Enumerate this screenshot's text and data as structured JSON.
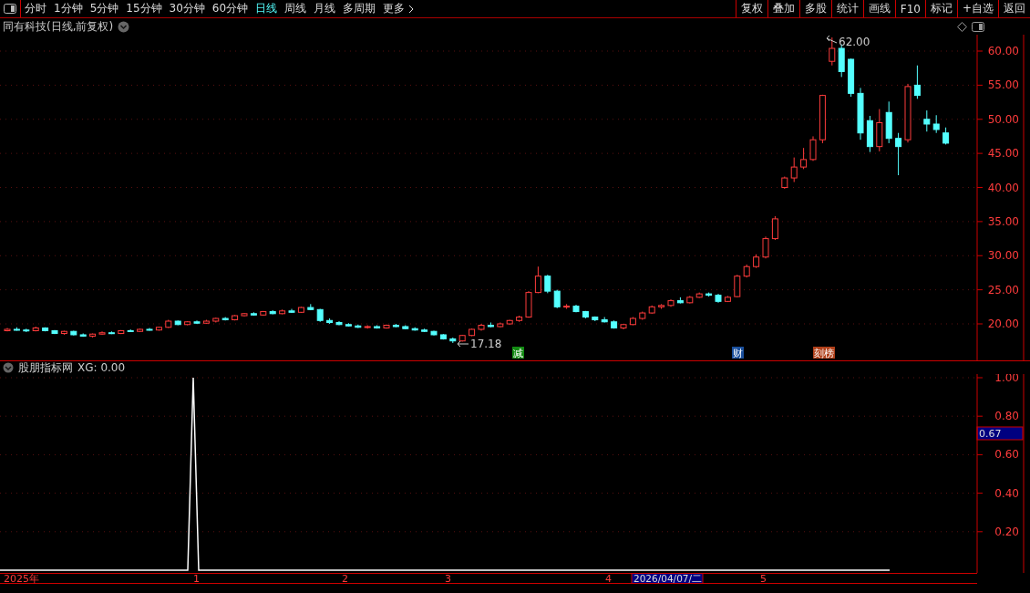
{
  "toolbar": {
    "periods": [
      {
        "label": "分时",
        "selected": false
      },
      {
        "label": "1分钟",
        "selected": false
      },
      {
        "label": "5分钟",
        "selected": false
      },
      {
        "label": "15分钟",
        "selected": false
      },
      {
        "label": "30分钟",
        "selected": false
      },
      {
        "label": "60分钟",
        "selected": false
      },
      {
        "label": "日线",
        "selected": true
      },
      {
        "label": "周线",
        "selected": false
      },
      {
        "label": "月线",
        "selected": false
      },
      {
        "label": "多周期",
        "selected": false
      }
    ],
    "more": "更多",
    "actions": [
      "复权",
      "叠加",
      "多股",
      "统计",
      "画线",
      "F10",
      "标记",
      "+自选",
      "返回"
    ]
  },
  "main_chart": {
    "title": "同有科技(日线,前复权)",
    "high_label": "62.00",
    "low_label": "17.18",
    "chart_data": {
      "type": "candlestick",
      "ylim": [
        14.65,
        62.41
      ],
      "grid": true,
      "yticks": [
        {
          "value": 60,
          "label": "60.00"
        },
        {
          "value": 55,
          "label": "55.00"
        },
        {
          "value": 50,
          "label": "50.00"
        },
        {
          "value": 45,
          "label": "45.00"
        },
        {
          "value": 40,
          "label": "40.00"
        },
        {
          "value": 35,
          "label": "35.00"
        },
        {
          "value": 30,
          "label": "30.00"
        },
        {
          "value": 25,
          "label": "25.00"
        },
        {
          "value": 20,
          "label": "20.00"
        }
      ],
      "ohlc": [
        [
          19.0,
          19.4,
          18.9,
          19.2
        ],
        [
          19.2,
          19.5,
          19.0,
          19.1
        ],
        [
          19.1,
          19.3,
          18.8,
          19.0
        ],
        [
          19.0,
          19.6,
          18.9,
          19.4
        ],
        [
          19.4,
          19.5,
          18.9,
          19.0
        ],
        [
          19.0,
          19.1,
          18.5,
          18.6
        ],
        [
          18.6,
          19.0,
          18.4,
          18.9
        ],
        [
          18.9,
          19.0,
          18.3,
          18.4
        ],
        [
          18.4,
          18.6,
          18.1,
          18.2
        ],
        [
          18.2,
          18.6,
          18.0,
          18.5
        ],
        [
          18.5,
          18.9,
          18.4,
          18.7
        ],
        [
          18.7,
          18.9,
          18.5,
          18.6
        ],
        [
          18.6,
          19.1,
          18.5,
          19.0
        ],
        [
          19.0,
          19.2,
          18.8,
          18.9
        ],
        [
          18.9,
          19.3,
          18.8,
          19.2
        ],
        [
          19.2,
          19.4,
          19.0,
          19.1
        ],
        [
          19.1,
          19.6,
          19.0,
          19.5
        ],
        [
          19.5,
          20.6,
          19.4,
          20.4
        ],
        [
          20.4,
          20.5,
          19.8,
          19.9
        ],
        [
          19.9,
          20.4,
          19.8,
          20.3
        ],
        [
          20.3,
          20.5,
          20.0,
          20.1
        ],
        [
          20.1,
          20.6,
          20.0,
          20.4
        ],
        [
          20.4,
          20.9,
          20.2,
          20.8
        ],
        [
          20.8,
          21.0,
          20.5,
          20.6
        ],
        [
          20.6,
          21.3,
          20.5,
          21.2
        ],
        [
          21.2,
          21.6,
          21.1,
          21.5
        ],
        [
          21.5,
          21.7,
          21.2,
          21.3
        ],
        [
          21.3,
          21.9,
          21.2,
          21.8
        ],
        [
          21.8,
          22.0,
          21.4,
          21.5
        ],
        [
          21.5,
          22.1,
          21.4,
          21.9
        ],
        [
          21.9,
          22.2,
          21.6,
          21.7
        ],
        [
          21.7,
          22.5,
          21.6,
          22.4
        ],
        [
          22.4,
          22.9,
          22.0,
          22.1
        ],
        [
          22.1,
          22.2,
          20.3,
          20.5
        ],
        [
          20.5,
          20.8,
          20.0,
          20.2
        ],
        [
          20.2,
          20.4,
          19.8,
          19.9
        ],
        [
          19.9,
          20.1,
          19.6,
          19.7
        ],
        [
          19.7,
          19.9,
          19.4,
          19.5
        ],
        [
          19.5,
          19.8,
          19.3,
          19.6
        ],
        [
          19.6,
          19.8,
          19.3,
          19.4
        ],
        [
          19.4,
          19.9,
          19.3,
          19.8
        ],
        [
          19.8,
          20.0,
          19.5,
          19.6
        ],
        [
          19.6,
          19.8,
          19.2,
          19.3
        ],
        [
          19.3,
          19.5,
          19.0,
          19.1
        ],
        [
          19.1,
          19.3,
          18.8,
          18.9
        ],
        [
          18.9,
          19.0,
          18.3,
          18.4
        ],
        [
          18.4,
          18.5,
          17.7,
          17.8
        ],
        [
          17.8,
          18.0,
          17.2,
          17.5
        ],
        [
          17.5,
          18.4,
          17.4,
          18.3
        ],
        [
          18.3,
          19.3,
          18.2,
          19.2
        ],
        [
          19.2,
          20.0,
          19.0,
          19.8
        ],
        [
          19.8,
          20.2,
          19.5,
          19.6
        ],
        [
          19.6,
          20.2,
          19.5,
          20.0
        ],
        [
          20.0,
          20.6,
          19.9,
          20.5
        ],
        [
          20.5,
          21.2,
          20.3,
          21.0
        ],
        [
          21.0,
          24.8,
          20.9,
          24.6
        ],
        [
          24.6,
          28.4,
          24.5,
          27.0
        ],
        [
          27.0,
          27.2,
          24.5,
          24.8
        ],
        [
          24.8,
          25.0,
          22.3,
          22.5
        ],
        [
          22.5,
          22.9,
          22.2,
          22.6
        ],
        [
          22.6,
          22.8,
          21.7,
          21.8
        ],
        [
          21.8,
          21.9,
          20.8,
          21.0
        ],
        [
          21.0,
          21.1,
          20.4,
          20.6
        ],
        [
          20.6,
          21.0,
          20.2,
          20.3
        ],
        [
          20.3,
          20.5,
          19.3,
          19.4
        ],
        [
          19.4,
          20.0,
          19.2,
          19.9
        ],
        [
          19.9,
          21.0,
          19.8,
          20.8
        ],
        [
          20.8,
          21.8,
          20.6,
          21.6
        ],
        [
          21.6,
          22.7,
          21.5,
          22.5
        ],
        [
          22.5,
          22.9,
          22.2,
          22.7
        ],
        [
          22.7,
          23.6,
          22.5,
          23.4
        ],
        [
          23.4,
          23.9,
          23.0,
          23.1
        ],
        [
          23.1,
          24.1,
          23.0,
          23.9
        ],
        [
          23.9,
          24.6,
          23.8,
          24.4
        ],
        [
          24.4,
          24.6,
          24.0,
          24.2
        ],
        [
          24.2,
          24.4,
          23.1,
          23.3
        ],
        [
          23.3,
          24.1,
          23.2,
          23.9
        ],
        [
          24.0,
          27.2,
          23.9,
          27.0
        ],
        [
          27.0,
          28.7,
          26.8,
          28.4
        ],
        [
          28.4,
          30.2,
          28.2,
          29.8
        ],
        [
          29.8,
          32.8,
          29.6,
          32.5
        ],
        [
          32.5,
          35.8,
          32.3,
          35.4
        ],
        [
          40.0,
          41.6,
          39.8,
          41.4
        ],
        [
          41.4,
          44.4,
          40.8,
          43.0
        ],
        [
          43.0,
          45.8,
          42.7,
          44.1
        ],
        [
          44.1,
          47.5,
          43.9,
          47.0
        ],
        [
          47.0,
          53.6,
          46.5,
          53.5
        ],
        [
          58.5,
          62.0,
          57.9,
          60.4
        ],
        [
          60.4,
          61.0,
          56.2,
          57.0
        ],
        [
          58.8,
          58.9,
          53.3,
          53.8
        ],
        [
          53.8,
          54.6,
          47.0,
          48.0
        ],
        [
          49.8,
          50.5,
          45.2,
          46.0
        ],
        [
          46.0,
          51.5,
          45.3,
          49.5
        ],
        [
          51.0,
          52.6,
          46.5,
          47.2
        ],
        [
          47.2,
          48.0,
          41.8,
          46.0
        ],
        [
          47.0,
          55.2,
          46.6,
          54.8
        ],
        [
          55.0,
          57.9,
          53.0,
          53.5
        ],
        [
          50.0,
          51.3,
          48.2,
          49.3
        ],
        [
          49.3,
          50.6,
          48.0,
          48.5
        ],
        [
          48.0,
          48.8,
          46.3,
          46.5
        ]
      ]
    },
    "event_markers": [
      {
        "label": "减",
        "color": "#138a13"
      },
      {
        "label": "财",
        "color": "#1a4f9c"
      },
      {
        "label": "刻榜",
        "color": "#b0401a"
      }
    ]
  },
  "indicator": {
    "title": "股朋指标网",
    "reading": "XG: 0.00",
    "ticks": [
      "1.00",
      "0.80",
      "0.60",
      "0.40",
      "0.20"
    ],
    "cursor_value": "0.67"
  },
  "time_axis": {
    "labels": [
      "2025年",
      "1",
      "2",
      "3",
      "4",
      "5"
    ],
    "cursor_date": "2026/04/07/二"
  }
}
